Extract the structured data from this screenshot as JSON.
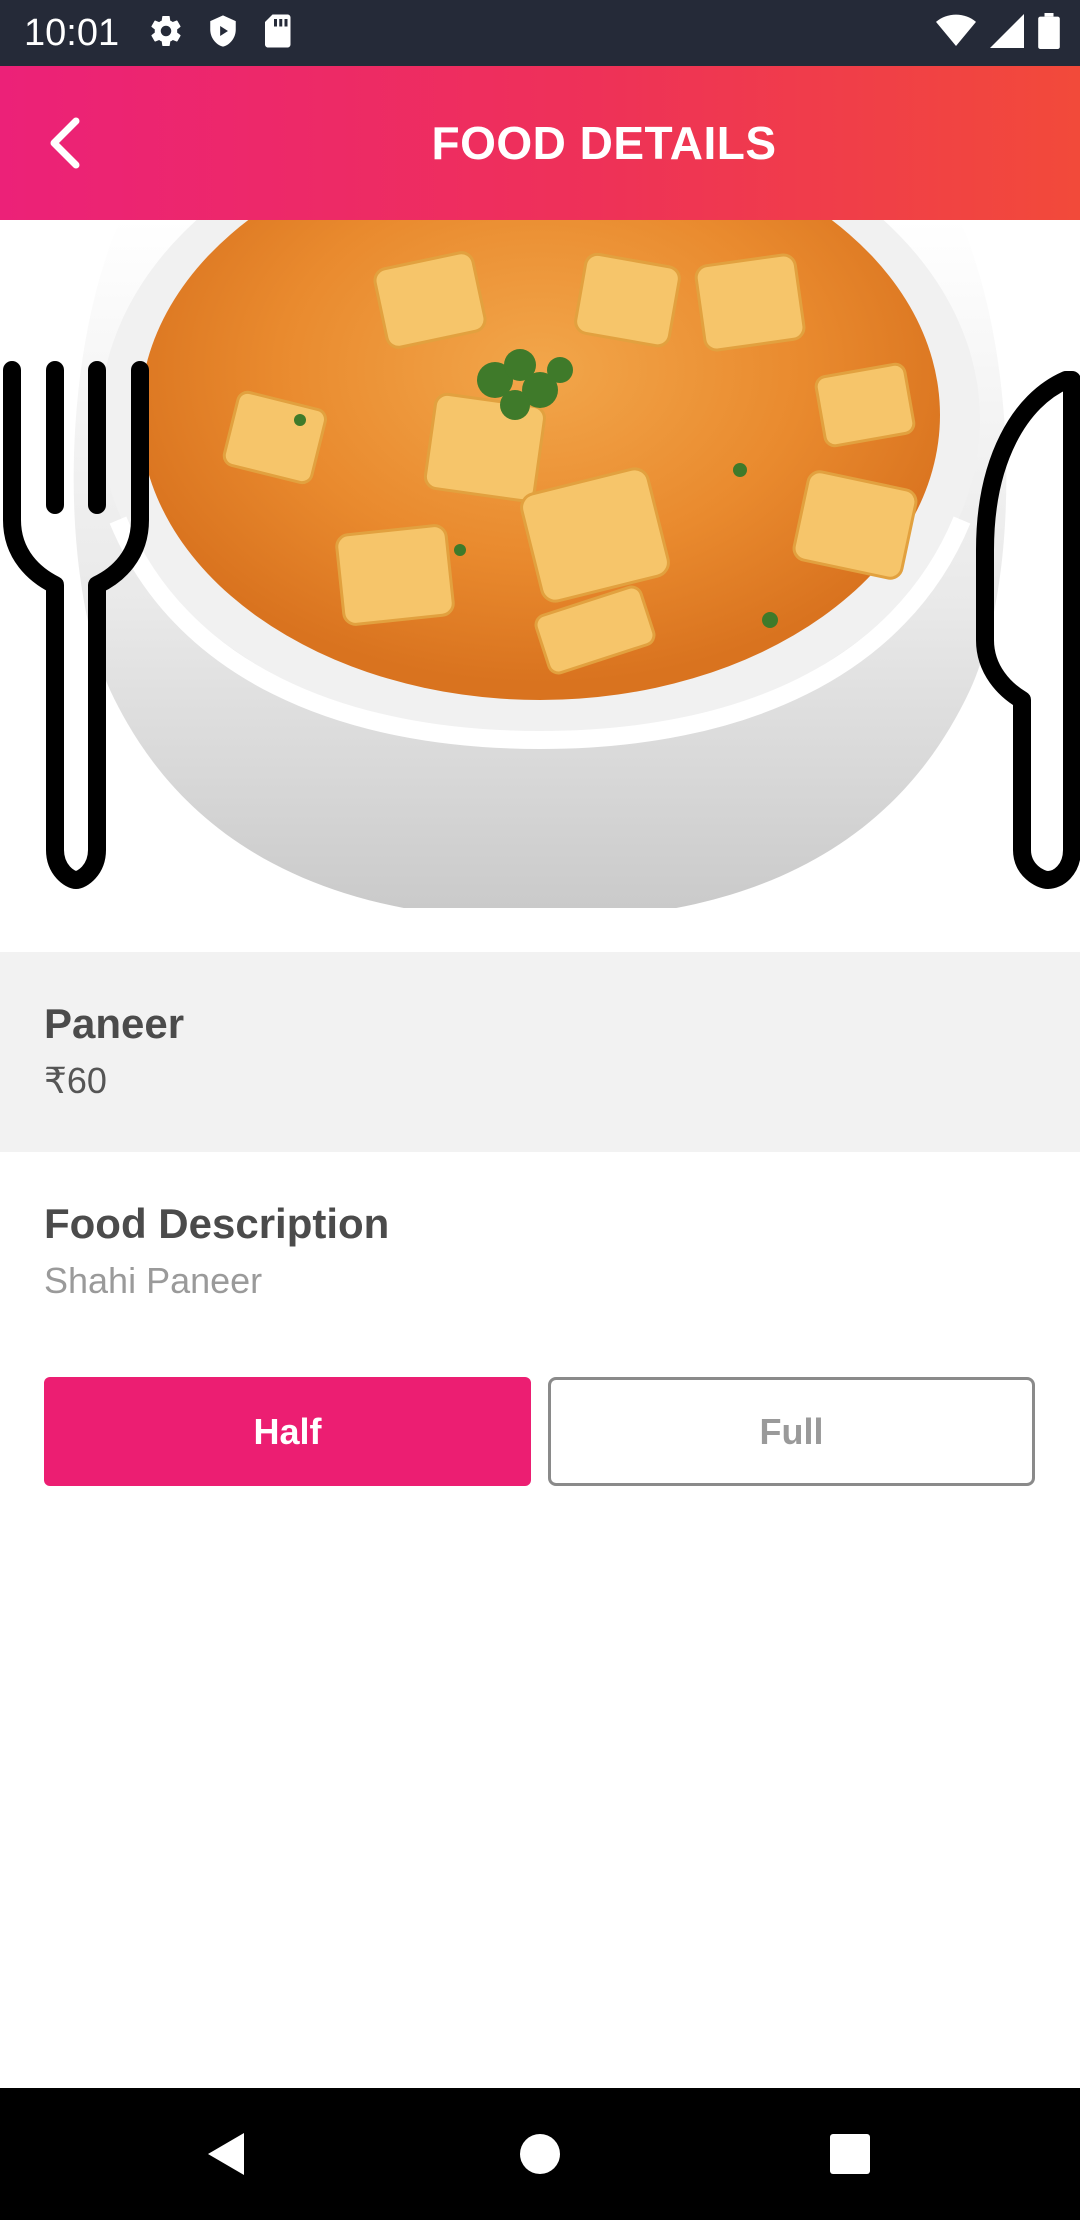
{
  "status_bar": {
    "time": "10:01",
    "left_icons": [
      "settings-icon",
      "shield-icon",
      "sd-card-icon"
    ],
    "right_icons": [
      "wifi-icon",
      "signal-icon",
      "battery-icon"
    ]
  },
  "app_bar": {
    "title": "FOOD DETAILS",
    "back_icon": "chevron-left-icon",
    "gradient_colors": [
      "#ec2178",
      "#f24a3a"
    ]
  },
  "food": {
    "image": "food-image",
    "name": "Paneer",
    "price": "₹60",
    "description_title": "Food Description",
    "description": "Shahi Paneer"
  },
  "portion": {
    "half_label": "Half",
    "full_label": "Full",
    "selected": "Half",
    "accent_color": "#ec1e72"
  },
  "nav_bar": {
    "icons": [
      "back-triangle-icon",
      "home-circle-icon",
      "recents-square-icon"
    ]
  }
}
